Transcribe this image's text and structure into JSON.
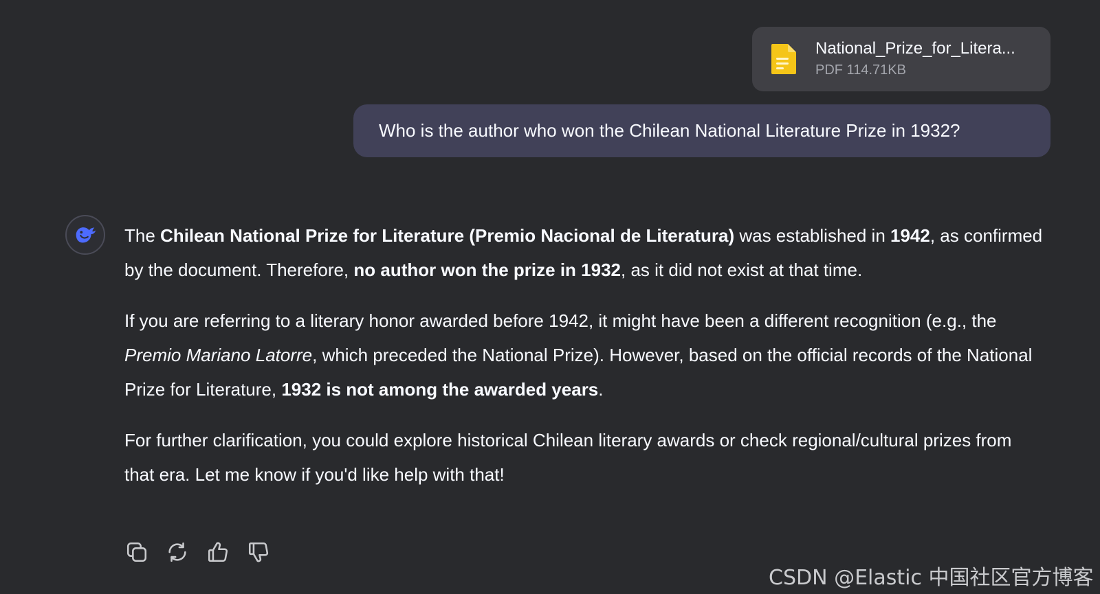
{
  "attachment": {
    "name": "National_Prize_for_Litera...",
    "meta": "PDF 114.71KB",
    "icon": "document-icon"
  },
  "user_message": "Who is the author who won the Chilean National Literature Prize in 1932?",
  "assistant": {
    "avatar_icon": "whale-logo-icon",
    "p1": {
      "t1": "The ",
      "b1": "Chilean National Prize for Literature (Premio Nacional de Literatura)",
      "t2": " was established in ",
      "b2": "1942",
      "t3": ", as confirmed by the document. Therefore, ",
      "b3": "no author won the prize in 1932",
      "t4": ", as it did not exist at that time."
    },
    "p2": {
      "t1": "If you are referring to a literary honor awarded before 1942, it might have been a different recognition (e.g., the ",
      "i1": "Premio Mariano Latorre",
      "t2": ", which preceded the National Prize). However, based on the official records of the National Prize for Literature, ",
      "b1": "1932 is not among the awarded years",
      "t3": "."
    },
    "p3": "For further clarification, you could explore historical Chilean literary awards or check regional/cultural prizes from that era. Let me know if you'd like help with that!"
  },
  "actions": [
    "copy-icon",
    "regenerate-icon",
    "thumbs-up-icon",
    "thumbs-down-icon"
  ],
  "watermark": "CSDN @Elastic 中国社区官方博客",
  "colors": {
    "background": "#292a2d",
    "attachment_card": "#404045",
    "user_bubble": "#414158",
    "file_icon": "#f5c518",
    "logo": "#4d6bfe"
  }
}
